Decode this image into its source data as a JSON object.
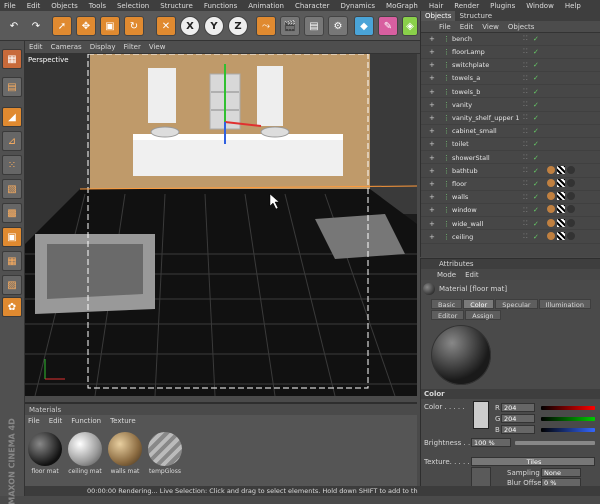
{
  "menubar": {
    "items": [
      "File",
      "Edit",
      "Objects",
      "Tools",
      "Selection",
      "Structure",
      "Functions",
      "Animation",
      "Character",
      "Dynamics",
      "MoGraph",
      "Hair",
      "Render",
      "Plugins",
      "Window",
      "Help"
    ]
  },
  "toolbar": {
    "icons": [
      "undo-icon",
      "redo-icon",
      "live-selection-icon",
      "move-icon",
      "scale-icon",
      "rotate-icon",
      "x-axis-icon",
      "y-axis-icon",
      "z-axis-icon",
      "coord-system-icon",
      "render-view-icon",
      "render-picture-viewer-icon",
      "render-settings-icon",
      "cube-icon",
      "pen-icon",
      "subdivision-icon",
      "array-icon",
      "deformer-icon",
      "scene-icon",
      "light-icon"
    ],
    "axis_labels": {
      "x": "X",
      "y": "Y",
      "z": "Z"
    }
  },
  "viewport": {
    "menu": [
      "Edit",
      "Cameras",
      "Display",
      "Filter",
      "View"
    ],
    "label": "Perspective"
  },
  "objects_panel": {
    "tabs": [
      "Objects",
      "Structure"
    ],
    "menu": [
      "File",
      "Edit",
      "View",
      "Objects"
    ],
    "rows": [
      {
        "name": "bench"
      },
      {
        "name": "floorLamp"
      },
      {
        "name": "switchplate"
      },
      {
        "name": "towels_a"
      },
      {
        "name": "towels_b"
      },
      {
        "name": "vanity"
      },
      {
        "name": "vanity_shelf_upper 1"
      },
      {
        "name": "cabinet_small"
      },
      {
        "name": "toilet"
      },
      {
        "name": "showerStall"
      },
      {
        "name": "bathtub"
      },
      {
        "name": "floor"
      },
      {
        "name": "walls"
      },
      {
        "name": "window"
      },
      {
        "name": "wide_wall"
      },
      {
        "name": "ceiling"
      }
    ]
  },
  "attributes_panel": {
    "title": "Attributes",
    "menu": [
      "Mode",
      "Edit"
    ],
    "material_name": "Material [floor mat]",
    "tabs_row1": [
      "Basic",
      "Color",
      "Specular",
      "Illumination"
    ],
    "tabs_row2": [
      "Editor",
      "Assign"
    ],
    "active_tab": "Color",
    "section": "Color",
    "color_label": "Color . . . . .",
    "r_label": "R",
    "g_label": "G",
    "b_label": "B",
    "r_value": "204",
    "g_value": "204",
    "b_value": "204",
    "brightness_label": "Brightness . .",
    "brightness_value": "100 %",
    "texture_label": "Texture. . . . .",
    "texture_value": "Tiles",
    "sampling_label": "Sampling",
    "sampling_value": "None",
    "blur_offset_label": "Blur Offset",
    "blur_offset_value": "0 %"
  },
  "materials_panel": {
    "title": "Materials",
    "menu": [
      "File",
      "Edit",
      "Function",
      "Texture"
    ],
    "items": [
      {
        "label": "floor mat"
      },
      {
        "label": "ceiling mat"
      },
      {
        "label": "walls mat"
      },
      {
        "label": "tempGloss"
      }
    ]
  },
  "statusbar": {
    "text": "00:00:00 Rendering...    Live Selection: Click and drag to select elements. Hold down SHIFT to add to th"
  },
  "brand": "MAXON CINEMA 4D",
  "colors": {
    "accent": "#ff9a3a",
    "selection": "#3a6fa8",
    "axis_x": "#e03030",
    "axis_y": "#30c030",
    "axis_z": "#3060e0"
  }
}
